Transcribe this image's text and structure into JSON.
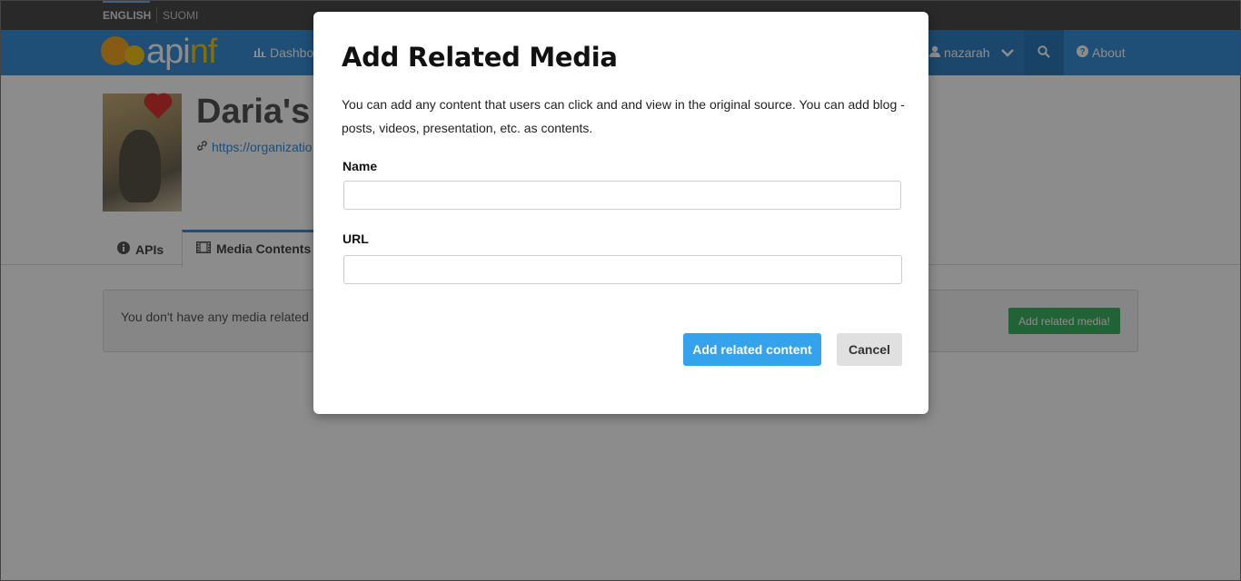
{
  "language_bar": {
    "active": "ENGLISH",
    "other": "SUOMI"
  },
  "navbar": {
    "logo_text_a": "api",
    "logo_text_b": "nf",
    "dashboard_label": "Dashbo",
    "user_name": "nazarah",
    "about_label": "About"
  },
  "organization": {
    "title": "Daria's o",
    "link_text": "https://organizatio"
  },
  "tabs": [
    {
      "label": "APIs",
      "icon": "info-circle-icon"
    },
    {
      "label": "Media Contents",
      "icon": "film-icon"
    }
  ],
  "media_panel": {
    "empty_text": "You don't have any media related",
    "add_button": "Add related media!"
  },
  "modal": {
    "title": "Add Related Media",
    "description": "You can add any content that users can click and  and view in the original source. You can add blog -posts, videos, presentation, etc. as contents.",
    "name_label": "Name",
    "name_value": "",
    "url_label": "URL",
    "url_value": "",
    "submit_label": "Add related content",
    "cancel_label": "Cancel"
  },
  "colors": {
    "navbar": "#3a8fd8",
    "primary_button": "#34a3eb",
    "success_button": "#3cb464"
  }
}
